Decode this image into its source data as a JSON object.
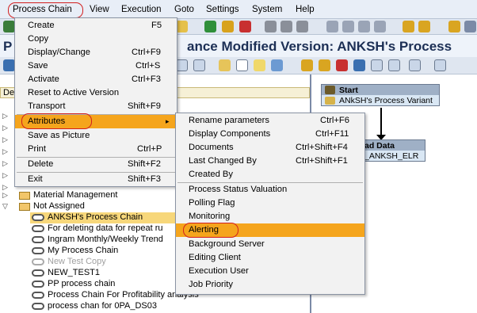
{
  "menubar": {
    "items": [
      "Process Chain",
      "View",
      "Execution",
      "Goto",
      "Settings",
      "System",
      "Help"
    ]
  },
  "title": {
    "prefix": "P",
    "text": "ance Modified Version: ANKSH's Process"
  },
  "left_header": "De",
  "process_chain_menu": {
    "items": [
      {
        "label": "Create",
        "shortcut": "F5"
      },
      {
        "label": "Copy",
        "shortcut": ""
      },
      {
        "label": "Display/Change",
        "shortcut": "Ctrl+F9"
      },
      {
        "label": "Save",
        "shortcut": "Ctrl+S"
      },
      {
        "label": "Activate",
        "shortcut": "Ctrl+F3"
      },
      {
        "label": "Reset to Active Version",
        "shortcut": ""
      },
      {
        "label": "Transport",
        "shortcut": "Shift+F9"
      },
      {
        "label": "Attributes",
        "shortcut": "▸"
      },
      {
        "label": "Save as Picture",
        "shortcut": ""
      },
      {
        "label": "Print",
        "shortcut": "Ctrl+P"
      },
      {
        "label": "Delete",
        "shortcut": "Shift+F2"
      },
      {
        "label": "Exit",
        "shortcut": "Shift+F3"
      }
    ]
  },
  "attributes_menu": {
    "items": [
      {
        "label": "Rename parameters",
        "shortcut": "Ctrl+F6"
      },
      {
        "label": "Display Components",
        "shortcut": "Ctrl+F11"
      },
      {
        "label": "Documents",
        "shortcut": "Ctrl+Shift+F4"
      },
      {
        "label": "Last Changed By",
        "shortcut": "Ctrl+Shift+F1"
      },
      {
        "label": "Created By",
        "shortcut": ""
      },
      {
        "label": "Process Status Valuation",
        "shortcut": ""
      },
      {
        "label": "Polling Flag",
        "shortcut": ""
      },
      {
        "label": "Monitoring",
        "shortcut": ""
      },
      {
        "label": "Alerting",
        "shortcut": ""
      },
      {
        "label": "Background Server",
        "shortcut": ""
      },
      {
        "label": "Editing Client",
        "shortcut": ""
      },
      {
        "label": "Execution User",
        "shortcut": ""
      },
      {
        "label": "Job Priority",
        "shortcut": ""
      }
    ]
  },
  "tree": {
    "material_management": "Material Management",
    "not_assigned": "Not Assigned",
    "chains": [
      "ANKSH's Process Chain",
      "For deleting data for repeat ru",
      "Ingram Monthly/Weekly Trend",
      "My Process Chain",
      "New Test Copy",
      "NEW_TEST1",
      "PP process chain",
      "Process Chain For Profitability analysis",
      "process chan for 0PA_DS03"
    ]
  },
  "diagram": {
    "start_header": "Start",
    "start_body": "ANkSH's Process Variant",
    "load_header": "ad Data",
    "load_body": "_ANKSH_ELR"
  }
}
